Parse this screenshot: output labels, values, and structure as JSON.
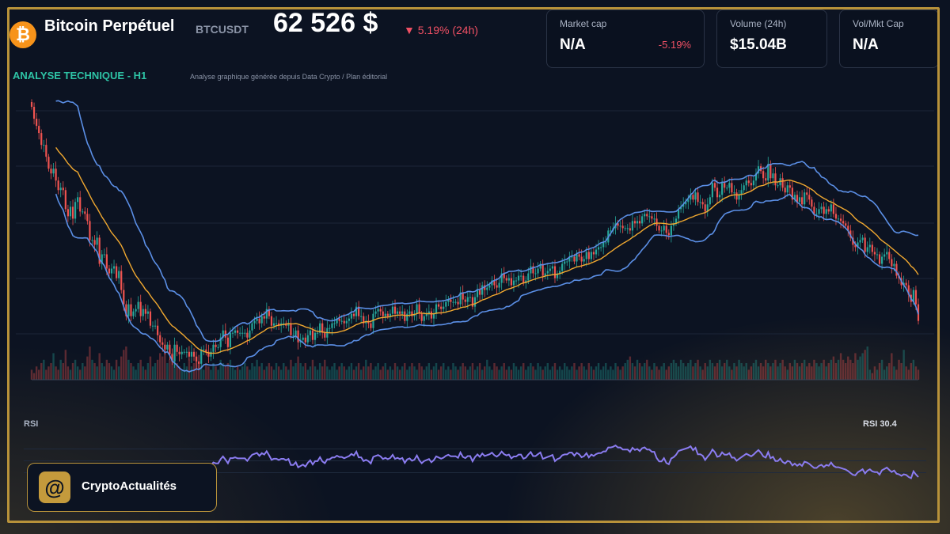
{
  "header": {
    "coin_glyph": "₿",
    "name": "Bitcoin Perpétuel",
    "symbol": "BTCUSDT",
    "price": "62 526 $",
    "change": "▼ 5.19% (24h)"
  },
  "cards": [
    {
      "label": "Market cap",
      "value": "N/A",
      "change": "-5.19%"
    },
    {
      "label": "Volume (24h)",
      "value": "$15.04B"
    },
    {
      "label": "Vol/Mkt Cap",
      "value": "N/A"
    }
  ],
  "section": {
    "title": "ANALYSE TECHNIQUE - H1",
    "source": "Analyse graphique générée depuis Data Crypto / Plan éditorial"
  },
  "rsi": {
    "label": "RSI",
    "value_label": "RSI 30.4"
  },
  "brand": {
    "logo_glyph": "@",
    "name": "CryptoActualités"
  },
  "colors": {
    "up": "#26a69a",
    "down": "#ef5350",
    "ma": "#f0a830",
    "band": "#5b8fe6",
    "rsi": "#8b7cf0",
    "accent": "#b8923a"
  },
  "chart_data": {
    "type": "candlestick",
    "timeframe": "H1",
    "close": [
      71500,
      71000,
      70700,
      70400,
      69900,
      69900,
      69400,
      68900,
      68700,
      68900,
      68400,
      68000,
      68100,
      68000,
      67200,
      66900,
      67300,
      66800,
      67500,
      67700,
      67100,
      67100,
      67000,
      66700,
      65900,
      65900,
      65700,
      66000,
      64900,
      65300,
      65300,
      64700,
      64500,
      64700,
      64800,
      64300,
      64600,
      63800,
      63200,
      62700,
      63200,
      62700,
      62900,
      63000,
      63300,
      62700,
      63000,
      62800,
      62900,
      62300,
      62300,
      62300,
      61900,
      61600,
      61500,
      61300,
      61500,
      61100,
      60800,
      61500,
      61200,
      61100,
      61200,
      61200,
      61200,
      61000,
      61200,
      61000,
      60800,
      60700,
      61300,
      61300,
      61200,
      61000,
      61200,
      61500,
      61400,
      61400,
      61800,
      62100,
      61800,
      61400,
      62000,
      62000,
      62100,
      62000,
      62000,
      62000,
      62000,
      61800,
      62100,
      62400,
      62500,
      62600,
      62400,
      62700,
      62600,
      63000,
      62700,
      62300,
      62400,
      62400,
      62300,
      62400,
      62400,
      62300,
      62400,
      61900,
      61900,
      62100,
      61600,
      61700,
      61800,
      61600,
      61900,
      62100,
      61700,
      62000,
      62000,
      62400,
      62000,
      61800,
      62200,
      62200,
      62400,
      62400,
      62600,
      62500,
      62500,
      62400,
      62500,
      62600,
      62800,
      62700,
      63100,
      62700,
      62700,
      62400,
      62500,
      62400,
      62200,
      62800,
      62900,
      63000,
      62900,
      62700,
      62800,
      62700,
      62800,
      63100,
      62800,
      62900,
      62800,
      62900,
      62500,
      62800,
      62900,
      62700,
      62800,
      63200,
      62800,
      62500,
      62700,
      62800,
      62900,
      62600,
      62800,
      63200,
      63100,
      63000,
      63100,
      63300,
      63400,
      63300,
      63300,
      63300,
      63200,
      63700,
      63400,
      63300,
      63500,
      63500,
      63100,
      63500,
      63800,
      63600,
      64000,
      63800,
      63900,
      64000,
      64200,
      64000,
      63900,
      64100,
      64500,
      64300,
      64200,
      64300,
      64000,
      64200,
      64200,
      64400,
      64400,
      64100,
      64200,
      64500,
      64800,
      64500,
      64500,
      64700,
      64900,
      64400,
      64500,
      64600,
      64700,
      64800,
      64300,
      64500,
      64600,
      64900,
      65000,
      65000,
      65200,
      65200,
      65000,
      65300,
      65200,
      65000,
      65100,
      65400,
      65100,
      65400,
      65300,
      65500,
      65600,
      65600,
      65800,
      65800,
      66300,
      66300,
      66400,
      66600,
      66500,
      66500,
      66400,
      66400,
      66400,
      66300,
      66700,
      66600,
      66700,
      66600,
      66900,
      67000,
      66900,
      66900,
      66800,
      66800,
      66500,
      66300,
      66300,
      66500,
      66200,
      66100,
      66500,
      66600,
      66800,
      67200,
      67300,
      67400,
      67500,
      67600,
      67800,
      67600,
      67900,
      67500,
      67500,
      67400,
      67100,
      67400,
      67700,
      68300,
      68100,
      67700,
      67800,
      68300,
      68100,
      68100,
      68300,
      67900,
      67900,
      67600,
      67800,
      68000,
      68200,
      68400,
      68300,
      68200,
      68400,
      68700,
      69000,
      68800,
      68500,
      68400,
      69100,
      68500,
      68700,
      68200,
      68200,
      68500,
      68100,
      67900,
      68200,
      68100,
      67600,
      67800,
      67500,
      67700,
      67400,
      67900,
      67800,
      67600,
      67300,
      67000,
      67000,
      67200,
      67300,
      67000,
      67200,
      67100,
      67400,
      67000,
      66800,
      66800,
      66700,
      66600,
      66500,
      66300,
      66000,
      65700,
      65600,
      65800,
      65900,
      66000,
      65400,
      65600,
      65700,
      65400,
      65300,
      65300,
      64900,
      65200,
      65300,
      65400,
      65100,
      64800,
      64900,
      64400,
      64300,
      64000,
      64100,
      64000,
      63600,
      63300,
      63800,
      63200,
      62500
    ],
    "volume_index": [
      0.3,
      0.2,
      0.4,
      0.3,
      0.5,
      0.6,
      0.3,
      0.4,
      0.5,
      0.8,
      0.4,
      0.3,
      0.6,
      0.5,
      0.9,
      0.4,
      0.3,
      0.5,
      0.6,
      0.4,
      0.3,
      0.5,
      0.4,
      0.7,
      1.0,
      0.6,
      0.5,
      0.4,
      0.8,
      0.5,
      0.4,
      0.6,
      0.5,
      0.4,
      0.3,
      0.6,
      0.4,
      0.7,
      0.9,
      1.0,
      0.6,
      0.5,
      0.4,
      0.3,
      0.5,
      0.6,
      0.4,
      0.3,
      0.5,
      0.7,
      0.4,
      0.5,
      0.6,
      0.8,
      0.7,
      0.9,
      0.5,
      0.6,
      0.8,
      0.6,
      0.5,
      0.4,
      0.3,
      0.5,
      0.4,
      0.6,
      0.4,
      0.5,
      0.7,
      0.5,
      0.4,
      0.3,
      0.5,
      0.4,
      0.3,
      0.5,
      0.4,
      0.3,
      0.6,
      0.5,
      0.4,
      0.5,
      0.6,
      0.4,
      0.3,
      0.4,
      0.3,
      0.4,
      0.5,
      0.4,
      0.3,
      0.5,
      0.4,
      0.6,
      0.4,
      0.5,
      0.3,
      0.4,
      0.5,
      0.4,
      0.3,
      0.5,
      0.4,
      0.3,
      0.5,
      0.4,
      0.3,
      0.6,
      0.4,
      0.5,
      0.7,
      0.5,
      0.4,
      0.5,
      0.3,
      0.4,
      0.6,
      0.4,
      0.3,
      0.5,
      0.4,
      0.6,
      0.4,
      0.3,
      0.4,
      0.5,
      0.3,
      0.4,
      0.5,
      0.4,
      0.3,
      0.4,
      0.5,
      0.3,
      0.4,
      0.5,
      0.3,
      0.4,
      0.6,
      0.4,
      0.5,
      0.3,
      0.4,
      0.5,
      0.3,
      0.4,
      0.5,
      0.3,
      0.4,
      0.3,
      0.5,
      0.4,
      0.3,
      0.4,
      0.5,
      0.3,
      0.4,
      0.5,
      0.4,
      0.3,
      0.5,
      0.4,
      0.3,
      0.4,
      0.5,
      0.3,
      0.4,
      0.5,
      0.3,
      0.4,
      0.5,
      0.3,
      0.4,
      0.3,
      0.5,
      0.4,
      0.3,
      0.4,
      0.5,
      0.4,
      0.3,
      0.4,
      0.5,
      0.3,
      0.4,
      0.5,
      0.3,
      0.4,
      0.6,
      0.4,
      0.3,
      0.5,
      0.4,
      0.3,
      0.4,
      0.5,
      0.3,
      0.4,
      0.3,
      0.5,
      0.4,
      0.3,
      0.4,
      0.5,
      0.3,
      0.4,
      0.5,
      0.4,
      0.3,
      0.5,
      0.4,
      0.3,
      0.4,
      0.5,
      0.3,
      0.4,
      0.5,
      0.3,
      0.4,
      0.3,
      0.5,
      0.4,
      0.3,
      0.4,
      0.5,
      0.3,
      0.4,
      0.5,
      0.4,
      0.3,
      0.5,
      0.4,
      0.3,
      0.4,
      0.5,
      0.3,
      0.4,
      0.5,
      0.3,
      0.4,
      0.3,
      0.5,
      0.4,
      0.3,
      0.4,
      0.5,
      0.6,
      0.7,
      0.5,
      0.4,
      0.6,
      0.5,
      0.4,
      0.5,
      0.6,
      0.4,
      0.3,
      0.5,
      0.4,
      0.3,
      0.4,
      0.5,
      0.3,
      0.4,
      0.5,
      0.6,
      0.5,
      0.4,
      0.6,
      0.5,
      0.4,
      0.5,
      0.6,
      0.4,
      0.5,
      0.6,
      0.4,
      0.3,
      0.5,
      0.4,
      0.6,
      0.5,
      0.4,
      0.5,
      0.6,
      0.4,
      0.5,
      0.6,
      0.4,
      0.3,
      0.5,
      0.4,
      0.6,
      0.5,
      0.4,
      0.5,
      0.3,
      0.4,
      0.5,
      0.6,
      0.4,
      0.5,
      0.4,
      0.6,
      0.5,
      0.4,
      0.5,
      0.6,
      0.4,
      0.5,
      0.6,
      0.4,
      0.3,
      0.5,
      0.4,
      0.6,
      0.5,
      0.4,
      0.5,
      0.6,
      0.4,
      0.5,
      0.4,
      0.6,
      0.5,
      0.4,
      0.5,
      0.6,
      0.4,
      0.5,
      0.6,
      0.7,
      0.5,
      0.6,
      0.8,
      0.6,
      0.5,
      0.7,
      0.6,
      0.5,
      0.8,
      0.6,
      0.7,
      0.8,
      0.9,
      1.0
    ],
    "ma_period": 20,
    "bb_period": 20,
    "bb_k": 2,
    "rsi_period": 14,
    "rsi_range": [
      0,
      100
    ],
    "grid": true
  }
}
